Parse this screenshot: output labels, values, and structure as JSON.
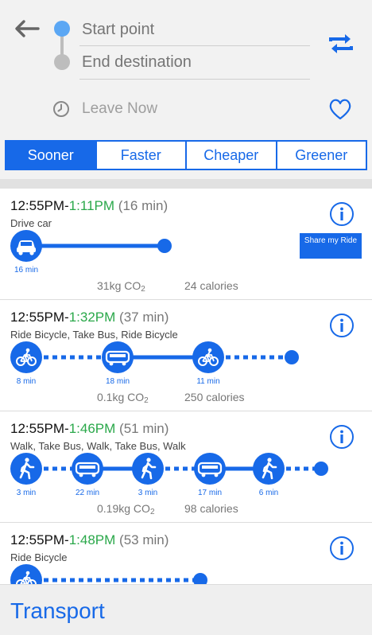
{
  "header": {
    "start_placeholder": "Start point",
    "end_placeholder": "End destination",
    "leave_label": "Leave Now"
  },
  "tabs": [
    {
      "label": "Sooner",
      "active": true
    },
    {
      "label": "Faster",
      "active": false
    },
    {
      "label": "Cheaper",
      "active": false
    },
    {
      "label": "Greener",
      "active": false
    }
  ],
  "routes": [
    {
      "start": "12:55PM",
      "end": "1:11PM",
      "duration": "(16 min)",
      "modes": "Drive car",
      "co2": "31kg CO",
      "co2_sub": "2",
      "calories": "24 calories",
      "share_label": "Share my Ride",
      "segments": [
        {
          "icon": "car-icon",
          "label": "16 min"
        }
      ]
    },
    {
      "start": "12:55PM",
      "end": "1:32PM",
      "duration": "(37 min)",
      "modes": "Ride Bicycle, Take Bus, Ride Bicycle",
      "co2": "0.1kg CO",
      "co2_sub": "2",
      "calories": "250 calories",
      "segments": [
        {
          "icon": "bicycle-icon",
          "label": "8 min"
        },
        {
          "icon": "bus-icon",
          "label": "18 min"
        },
        {
          "icon": "bicycle-icon",
          "label": "11 min"
        }
      ]
    },
    {
      "start": "12:55PM",
      "end": "1:46PM",
      "duration": "(51 min)",
      "modes": "Walk, Take Bus, Walk, Take Bus, Walk",
      "co2": "0.19kg CO",
      "co2_sub": "2",
      "calories": "98 calories",
      "segments": [
        {
          "icon": "walk-icon",
          "label": "3 min"
        },
        {
          "icon": "bus-icon",
          "label": "22 min"
        },
        {
          "icon": "walk-icon",
          "label": "3 min"
        },
        {
          "icon": "bus-icon",
          "label": "17 min"
        },
        {
          "icon": "walk-icon",
          "label": "6 min"
        }
      ]
    },
    {
      "start": "12:55PM",
      "end": "1:48PM",
      "duration": "(53 min)",
      "modes": "Ride Bicycle",
      "segments": [
        {
          "icon": "bicycle-icon",
          "label": ""
        }
      ]
    }
  ],
  "footer": {
    "title": "Transport"
  },
  "colors": {
    "accent": "#1769e8",
    "arrival_time": "#2aa84a",
    "start_dot": "#5ba7f4"
  }
}
